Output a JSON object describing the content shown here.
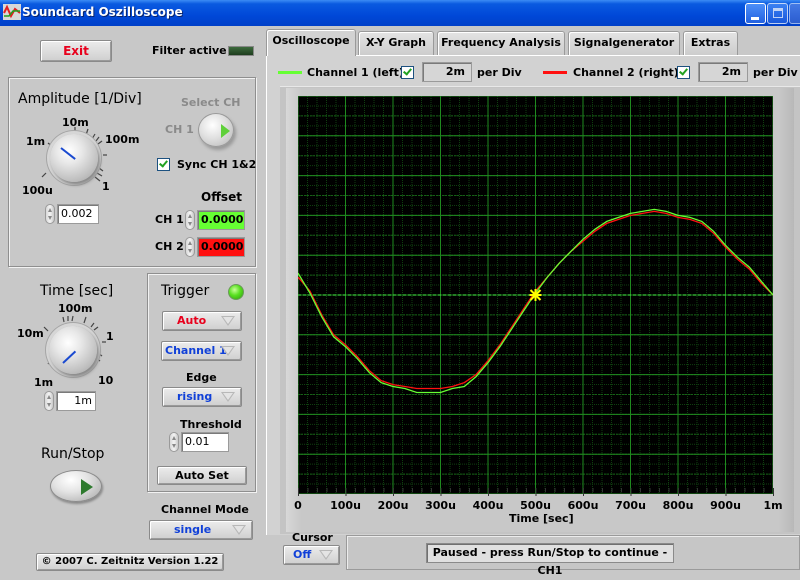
{
  "window": {
    "title": "Soundcard Oszilloscope",
    "buttons": [
      "minimize",
      "maximize",
      "close"
    ]
  },
  "top_left": {
    "exit_label": "Exit",
    "filter_label": "Filter active",
    "filter_active": false
  },
  "amplitude": {
    "title": "Amplitude [1/Div]",
    "knob_labels": [
      "100u",
      "1m",
      "10m",
      "100m",
      "1"
    ],
    "value": "0.002",
    "select_ch_label": "Select CH",
    "select_ch_value": "CH 1",
    "sync_label": "Sync CH 1&2",
    "sync_checked": true,
    "offset_title": "Offset",
    "ch1_label": "CH 1",
    "ch1_offset": "0.0000",
    "ch1_color": "#66ff33",
    "ch2_label": "CH 2",
    "ch2_offset": "0.0000",
    "ch2_color": "#ff1010"
  },
  "time": {
    "title": "Time [sec]",
    "knob_labels": [
      "1m",
      "10m",
      "100m",
      "1",
      "10"
    ],
    "value": "1m"
  },
  "trigger": {
    "title": "Trigger",
    "led_on": true,
    "mode": "Auto",
    "source": "Channel 1",
    "edge_label": "Edge",
    "edge": "rising",
    "threshold_label": "Threshold",
    "threshold": "0.01",
    "autoset_label": "Auto Set"
  },
  "run_stop": {
    "label": "Run/Stop"
  },
  "channel_mode": {
    "label": "Channel Mode",
    "value": "single"
  },
  "copyright": "© 2007   C. Zeitnitz Version 1.22",
  "tabs": [
    {
      "label": "Oscilloscope",
      "active": true
    },
    {
      "label": "X-Y Graph",
      "active": false
    },
    {
      "label": "Frequency Analysis",
      "active": false
    },
    {
      "label": "Signalgenerator",
      "active": false
    },
    {
      "label": "Extras",
      "active": false
    }
  ],
  "legend": {
    "ch1_label": "Channel 1 (left)",
    "ch1_checked": true,
    "ch1_perdiv": "2m",
    "ch2_label": "Channel 2 (right)",
    "ch2_checked": true,
    "ch2_perdiv": "2m",
    "perdiv_suffix": "per Div"
  },
  "cursor": {
    "label": "Cursor",
    "value": "Off"
  },
  "status": "Paused - press Run/Stop to continue - CH1",
  "chart_data": {
    "type": "line",
    "title": "",
    "xlabel": "Time [sec]",
    "ylabel": "",
    "x_tick_labels": [
      "0",
      "100u",
      "200u",
      "300u",
      "400u",
      "500u",
      "600u",
      "700u",
      "800u",
      "900u",
      "1m"
    ],
    "xlim_us": [
      0,
      1000
    ],
    "ylim_div": [
      -5,
      5
    ],
    "grid": true,
    "trigger_level_div": 0,
    "trigger_marker": {
      "t_us": 500,
      "y_div": 0,
      "color": "#ffff00"
    },
    "background": "#000000",
    "grid_color": "#1f8a1f",
    "series": [
      {
        "name": "Channel 1 (left)",
        "color": "#66ff33",
        "t_us": [
          0,
          25,
          50,
          75,
          100,
          125,
          150,
          175,
          200,
          225,
          250,
          275,
          300,
          325,
          350,
          375,
          400,
          425,
          450,
          475,
          500,
          525,
          550,
          575,
          600,
          625,
          650,
          675,
          700,
          725,
          750,
          775,
          800,
          825,
          850,
          875,
          900,
          925,
          950,
          975,
          1000
        ],
        "y_div": [
          0.55,
          0.05,
          -0.55,
          -1.05,
          -1.3,
          -1.6,
          -1.95,
          -2.2,
          -2.3,
          -2.35,
          -2.45,
          -2.45,
          -2.45,
          -2.35,
          -2.3,
          -2.05,
          -1.7,
          -1.3,
          -0.85,
          -0.4,
          0.05,
          0.45,
          0.8,
          1.1,
          1.4,
          1.65,
          1.85,
          1.95,
          2.05,
          2.1,
          2.15,
          2.1,
          2.0,
          1.95,
          1.85,
          1.6,
          1.25,
          0.95,
          0.7,
          0.35,
          0.0
        ]
      },
      {
        "name": "Channel 2 (right)",
        "color": "#ff1010",
        "t_us": [
          0,
          25,
          50,
          75,
          100,
          125,
          150,
          175,
          200,
          225,
          250,
          275,
          300,
          325,
          350,
          375,
          400,
          425,
          450,
          475,
          500,
          525,
          550,
          575,
          600,
          625,
          650,
          675,
          700,
          725,
          750,
          775,
          800,
          825,
          850,
          875,
          900,
          925,
          950,
          975,
          1000
        ],
        "y_div": [
          0.45,
          0.1,
          -0.5,
          -1.0,
          -1.25,
          -1.55,
          -1.9,
          -2.15,
          -2.25,
          -2.3,
          -2.35,
          -2.35,
          -2.35,
          -2.3,
          -2.2,
          -2.0,
          -1.65,
          -1.25,
          -0.8,
          -0.35,
          0.1,
          0.45,
          0.8,
          1.1,
          1.35,
          1.6,
          1.8,
          1.9,
          2.0,
          2.05,
          2.1,
          2.05,
          1.95,
          1.9,
          1.8,
          1.55,
          1.2,
          0.9,
          0.65,
          0.3,
          0.0
        ]
      }
    ]
  }
}
